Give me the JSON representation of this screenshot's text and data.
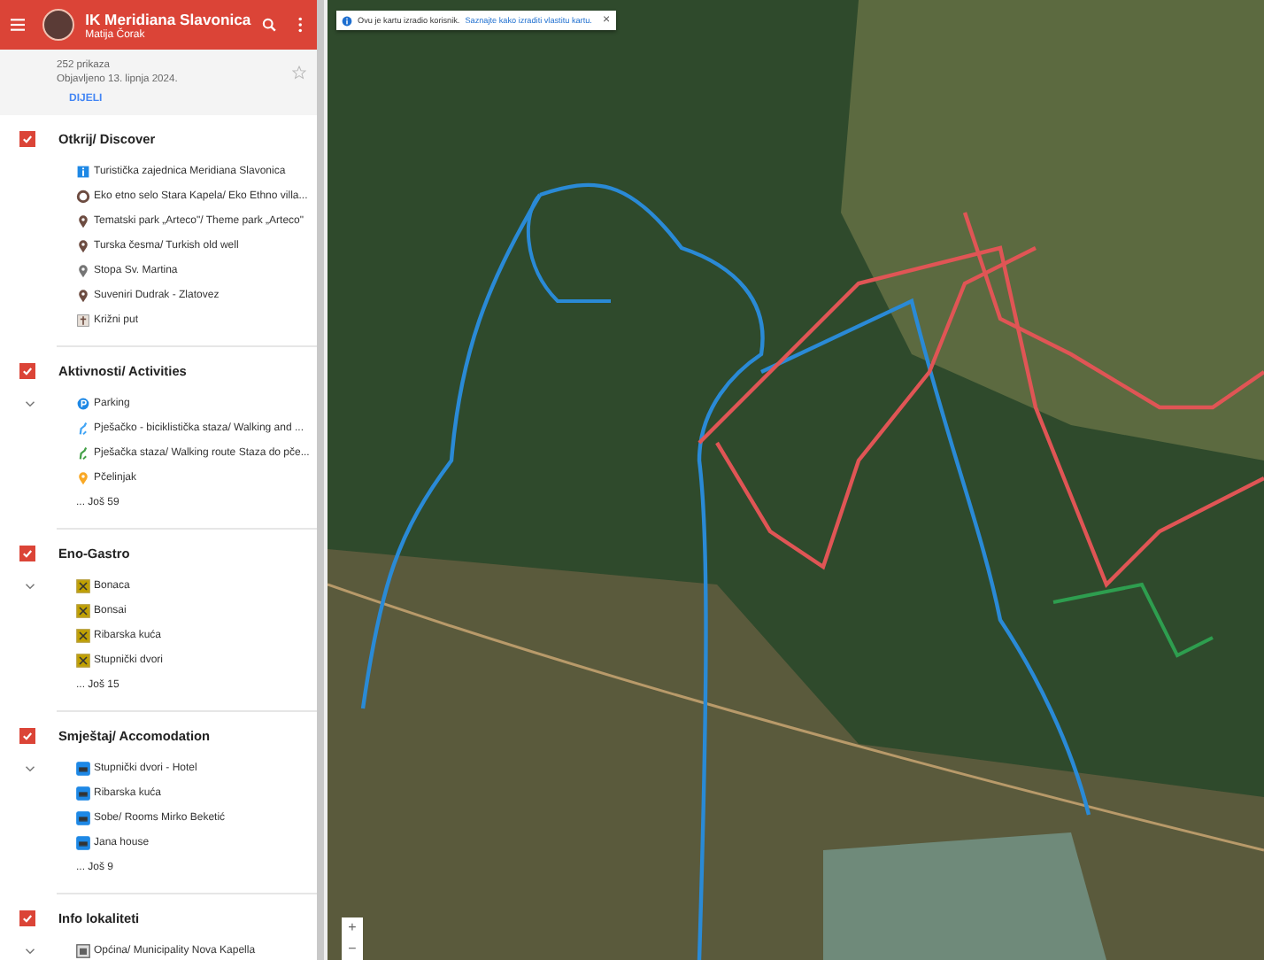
{
  "header": {
    "title": "IK Meridiana Slavonica",
    "author": "Matija Čorak"
  },
  "info": {
    "views": "252 prikaza",
    "published": "Objavljeno 13. lipnja 2024.",
    "share": "DIJELI",
    "starred": false
  },
  "layers": [
    {
      "title": "Otkrij/ Discover",
      "checked": true,
      "toggle": false,
      "items": [
        {
          "label": "Turistička zajednica Meridiana Slavonica",
          "kind": "info",
          "color": "#1e88e5"
        },
        {
          "label": "Eko etno selo Stara Kapela/  Eko Ethno villa...",
          "kind": "ring",
          "color": "#6d4c41"
        },
        {
          "label": "Tematski park „Arteco\"/ Theme park „Arteco\"",
          "kind": "pin",
          "color": "#6d4c41"
        },
        {
          "label": "Turska česma/ Turkish old well",
          "kind": "pin",
          "color": "#6d4c41"
        },
        {
          "label": "Stopa Sv. Martina",
          "kind": "pin",
          "color": "#757575"
        },
        {
          "label": "Suveniri Dudrak - Zlatovez",
          "kind": "pin",
          "color": "#6d4c41"
        },
        {
          "label": "Križni put",
          "kind": "cross",
          "color": "#e8e0d8"
        }
      ]
    },
    {
      "title": "Aktivnosti/ Activities",
      "checked": true,
      "toggle": true,
      "more": "... Još 59",
      "items": [
        {
          "label": "Parking",
          "kind": "parking",
          "color": "#1e88e5"
        },
        {
          "label": "Pješačko - biciklistička staza/ Walking and ...",
          "kind": "route",
          "color": "#42a5f5"
        },
        {
          "label": "Pješačka staza/ Walking route Staza do pče...",
          "kind": "route",
          "color": "#43a047"
        },
        {
          "label": "Pčelinjak",
          "kind": "pin",
          "color": "#f9a825"
        }
      ]
    },
    {
      "title": "Eno-Gastro",
      "checked": true,
      "toggle": true,
      "more": "... Još 15",
      "items": [
        {
          "label": "Bonaca",
          "kind": "food",
          "color": "#c0a000"
        },
        {
          "label": "Bonsai",
          "kind": "food",
          "color": "#c0a000"
        },
        {
          "label": "Ribarska kuća",
          "kind": "food",
          "color": "#c0a000"
        },
        {
          "label": "Stupnički dvori",
          "kind": "food",
          "color": "#c0a000"
        }
      ]
    },
    {
      "title": "Smještaj/ Accomodation",
      "checked": true,
      "toggle": true,
      "more": "... Još 9",
      "items": [
        {
          "label": "Stupnički dvori - Hotel",
          "kind": "bed",
          "color": "#1e88e5"
        },
        {
          "label": "Ribarska kuća",
          "kind": "bed",
          "color": "#1e88e5"
        },
        {
          "label": "Sobe/ Rooms Mirko Beketić",
          "kind": "bed",
          "color": "#1e88e5"
        },
        {
          "label": "Jana house",
          "kind": "bed",
          "color": "#1e88e5"
        }
      ]
    },
    {
      "title": "Info lokaliteti",
      "checked": true,
      "toggle": true,
      "items": [
        {
          "label": "Općina/ Municipality Nova Kapella",
          "kind": "building",
          "color": "#616161"
        }
      ]
    }
  ],
  "notice": {
    "text": "Ovu je kartu izradio korisnik.",
    "link": "Saznajte kako izraditi vlastitu kartu.",
    "close": "×"
  },
  "zoom": {
    "in": "+",
    "out": "−"
  }
}
